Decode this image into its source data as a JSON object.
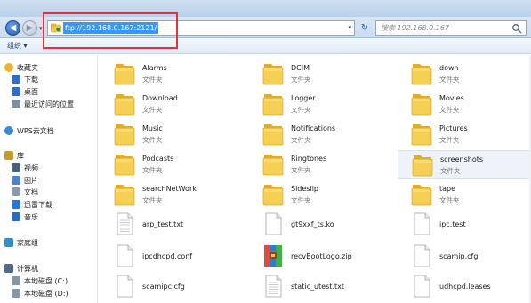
{
  "address_bar": {
    "url": "ftp://192.168.0.167:2121/",
    "search_placeholder": "搜索 192.168.0.167"
  },
  "toolbar": {
    "organize_label": "组织 ▾"
  },
  "sidebar": {
    "groups": [
      {
        "label": "收藏夹",
        "icon": "star-icon",
        "items": [
          {
            "label": "下载",
            "icon": "download-folder-icon"
          },
          {
            "label": "桌面",
            "icon": "desktop-icon"
          },
          {
            "label": "最近访问的位置",
            "icon": "recent-places-icon"
          }
        ]
      },
      {
        "label": "WPS云文档",
        "icon": "cloud-icon",
        "items": []
      },
      {
        "label": "库",
        "icon": "library-icon",
        "items": [
          {
            "label": "视频",
            "icon": "video-icon"
          },
          {
            "label": "图片",
            "icon": "picture-icon"
          },
          {
            "label": "文档",
            "icon": "document-icon"
          },
          {
            "label": "迅雷下载",
            "icon": "thunder-download-icon"
          },
          {
            "label": "音乐",
            "icon": "music-icon"
          }
        ]
      },
      {
        "label": "家庭组",
        "icon": "homegroup-icon",
        "items": []
      },
      {
        "label": "计算机",
        "icon": "computer-icon",
        "items": [
          {
            "label": "本地磁盘 (C:)",
            "icon": "disk-icon"
          },
          {
            "label": "本地磁盘 (D:)",
            "icon": "disk-icon"
          }
        ]
      }
    ]
  },
  "files": [
    {
      "name": "Alarms",
      "type": "文件夹",
      "kind": "folder"
    },
    {
      "name": "DCIM",
      "type": "文件夹",
      "kind": "folder"
    },
    {
      "name": "down",
      "type": "文件夹",
      "kind": "folder"
    },
    {
      "name": "Download",
      "type": "文件夹",
      "kind": "folder"
    },
    {
      "name": "Logger",
      "type": "文件夹",
      "kind": "folder"
    },
    {
      "name": "Movies",
      "type": "文件夹",
      "kind": "folder"
    },
    {
      "name": "Music",
      "type": "文件夹",
      "kind": "folder"
    },
    {
      "name": "Notifications",
      "type": "文件夹",
      "kind": "folder"
    },
    {
      "name": "Pictures",
      "type": "文件夹",
      "kind": "folder"
    },
    {
      "name": "Podcasts",
      "type": "文件夹",
      "kind": "folder"
    },
    {
      "name": "Ringtones",
      "type": "文件夹",
      "kind": "folder"
    },
    {
      "name": "screenshots",
      "type": "文件夹",
      "kind": "folder",
      "selected": true
    },
    {
      "name": "searchNetWork",
      "type": "文件夹",
      "kind": "folder"
    },
    {
      "name": "Sideslip",
      "type": "文件夹",
      "kind": "folder"
    },
    {
      "name": "tape",
      "type": "文件夹",
      "kind": "folder"
    },
    {
      "name": "arp_test.txt",
      "kind": "text"
    },
    {
      "name": "gt9xxf_ts.ko",
      "kind": "file"
    },
    {
      "name": "ipc.test",
      "kind": "file"
    },
    {
      "name": "ipcdhcpd.conf",
      "kind": "file"
    },
    {
      "name": "recvBootLogo.zip",
      "kind": "zip"
    },
    {
      "name": "scamip.cfg",
      "kind": "file"
    },
    {
      "name": "scamipc.cfg",
      "kind": "file"
    },
    {
      "name": "static_utest.txt",
      "kind": "text"
    },
    {
      "name": "udhcpd.leases",
      "kind": "file"
    }
  ],
  "colors": {
    "selection": "#3399ff",
    "highlight_box": "#e8303a",
    "folder": "#f3c84b"
  }
}
